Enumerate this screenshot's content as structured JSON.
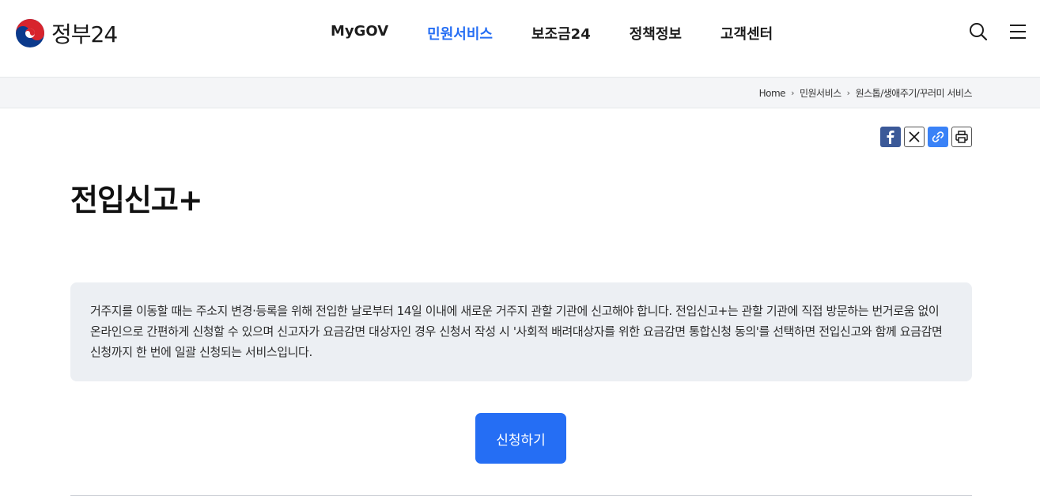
{
  "header": {
    "logo_text": "정부24",
    "nav": [
      {
        "label": "MyGOV",
        "active": false
      },
      {
        "label": "민원서비스",
        "active": true
      },
      {
        "label": "보조금24",
        "active": false
      },
      {
        "label": "정책정보",
        "active": false
      },
      {
        "label": "고객센터",
        "active": false
      }
    ],
    "icons": [
      "search-icon",
      "menu-icon"
    ]
  },
  "breadcrumb": {
    "items": [
      "Home",
      "민원서비스",
      "원스톱/생애주기/꾸러미 서비스"
    ]
  },
  "share": {
    "icons": [
      "facebook-icon",
      "x-icon",
      "link-icon",
      "print-icon"
    ]
  },
  "main": {
    "title": "전입신고+",
    "description": "거주지를 이동할 때는 주소지 변경·등록을 위해 전입한 날로부터 14일 이내에 새로운 거주지 관할 기관에 신고해야 합니다. 전입신고+는 관할 기관에 직접 방문하는 번거로움 없이 온라인으로 간편하게 신청할 수 있으며 신고자가 요금감면 대상자인 경우 신청서 작성 시 '사회적 배려대상자를 위한 요금감면 통합신청 동의'를 선택하면 전입신고와 함께 요금감면 신청까지 한 번에 일괄 신청되는 서비스입니다.",
    "apply_label": "신청하기"
  },
  "colors": {
    "accent": "#256ef4",
    "crumb_bg": "#f4f5f7",
    "desc_bg": "#eceff3"
  }
}
